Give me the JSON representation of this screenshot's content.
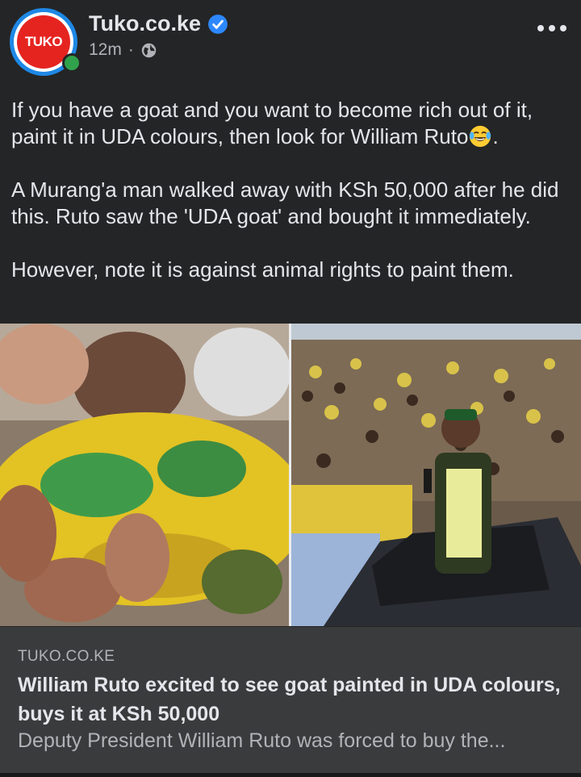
{
  "post": {
    "page_name": "Tuko.co.ke",
    "avatar_logo": "TUKO",
    "timestamp": "12m",
    "separator": "·",
    "privacy_icon": "globe-icon",
    "verified_icon": "verified-badge-icon",
    "more_icon": "more-options-icon",
    "caption": {
      "paragraph_1": "If you have a goat and you want to become rich out of it, paint it in UDA colours, then look for William Ruto",
      "paragraph_1_end": ".",
      "paragraph_1_emoji": "tears-of-joy-emoji",
      "paragraph_2": "A Murang'a man walked away with KSh 50,000 after he did this. Ruto saw the 'UDA goat' and bought it immediately.",
      "paragraph_3": "However, note it is against animal rights to paint them."
    },
    "images": [
      {
        "name": "goat-photo",
        "icon": "photo"
      },
      {
        "name": "rally-photo",
        "icon": "photo"
      }
    ],
    "link": {
      "domain": "TUKO.CO.KE",
      "title": "William Ruto excited to see goat painted in UDA colours, buys it at KSh 50,000",
      "description": "Deputy President William Ruto was forced to buy the..."
    }
  },
  "colors": {
    "background": "#242526",
    "text": "#e4e6eb",
    "secondary_text": "#b0b3b8",
    "link_bg": "#3a3b3c",
    "verified": "#2d88ff",
    "online": "#31a24c",
    "brand_red": "#e52420"
  }
}
